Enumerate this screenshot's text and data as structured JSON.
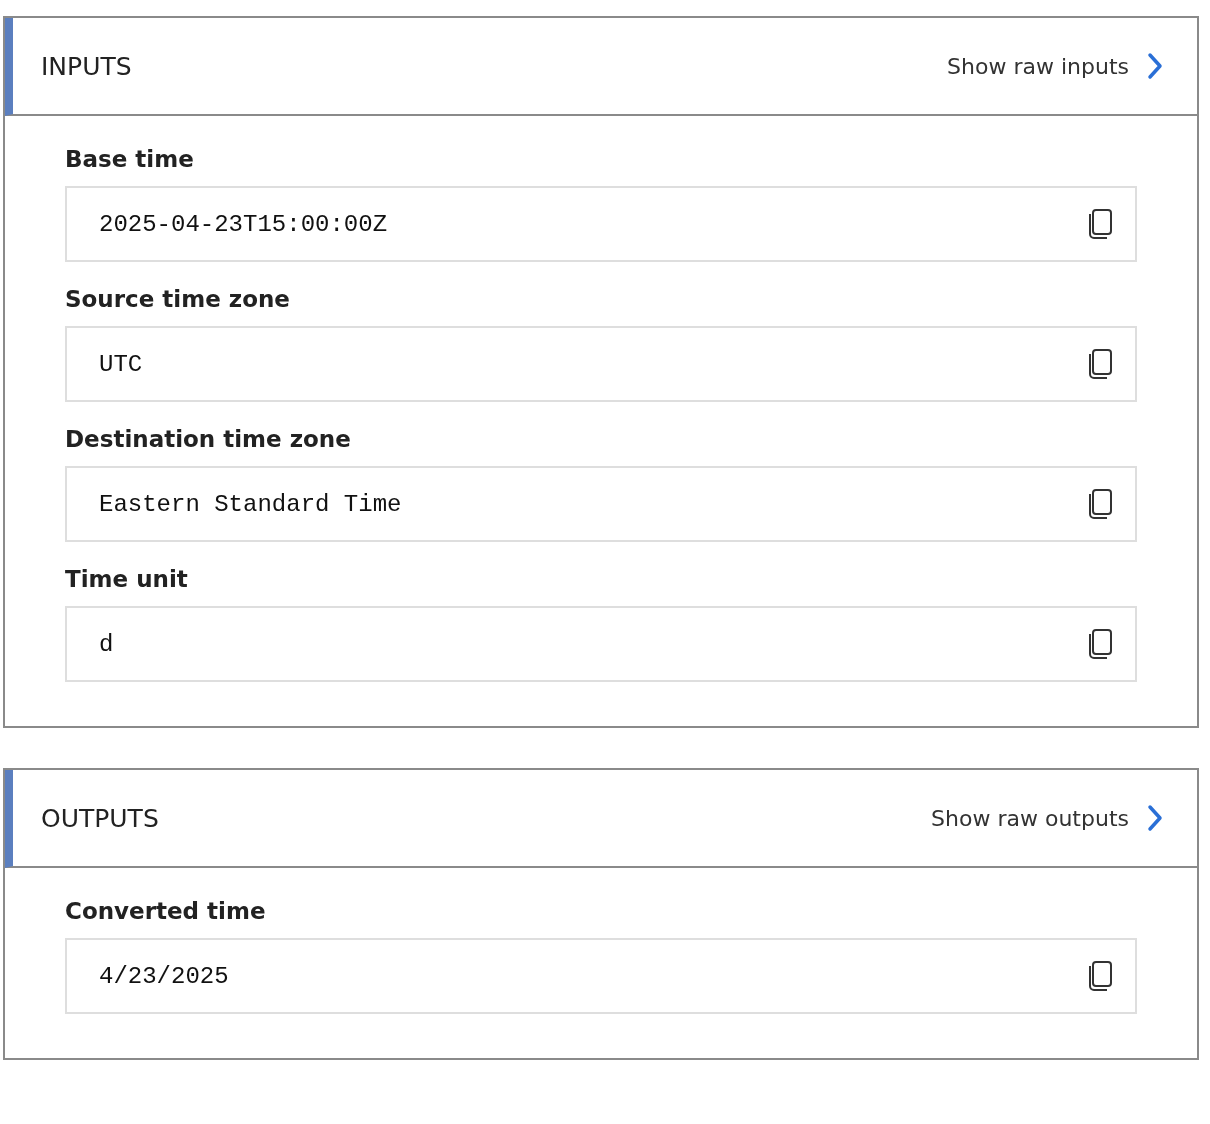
{
  "sections": [
    {
      "title": "INPUTS",
      "link": "Show raw inputs",
      "fields": [
        {
          "label": "Base time",
          "value": "2025-04-23T15:00:00Z"
        },
        {
          "label": "Source time zone",
          "value": "UTC"
        },
        {
          "label": "Destination time zone",
          "value": "Eastern Standard Time"
        },
        {
          "label": "Time unit",
          "value": "d"
        }
      ]
    },
    {
      "title": "OUTPUTS",
      "link": "Show raw outputs",
      "fields": [
        {
          "label": "Converted time",
          "value": "4/23/2025"
        }
      ]
    }
  ]
}
